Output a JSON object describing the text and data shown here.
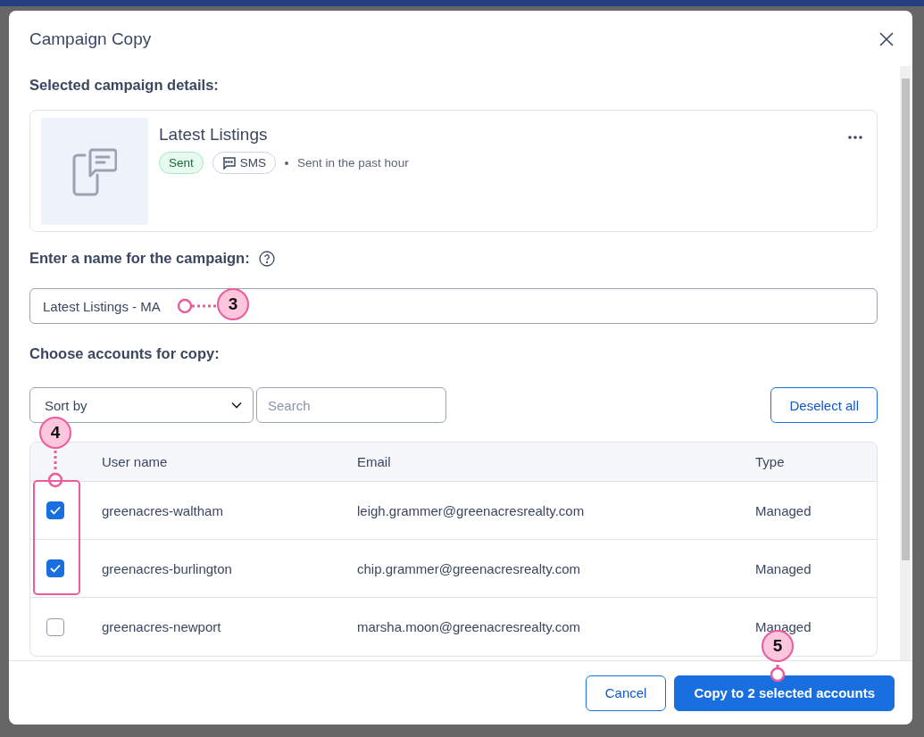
{
  "dialog": {
    "title": "Campaign Copy"
  },
  "campaign": {
    "section_label": "Selected campaign details:",
    "name": "Latest Listings",
    "status": "Sent",
    "channel": "SMS",
    "sent_info": "Sent in the past hour"
  },
  "name_field": {
    "label": "Enter a name for the campaign:",
    "value": "Latest Listings - MA"
  },
  "accounts": {
    "label": "Choose accounts for copy:",
    "sort_by": {
      "value": "Sort by"
    },
    "search": {
      "placeholder": "Search"
    },
    "deselect_button": "Deselect all",
    "columns": [
      "User name",
      "Email",
      "Type"
    ],
    "rows": [
      {
        "user": "greenacres-waltham",
        "email": "leigh.grammer@greenacresrealty.com",
        "type": "Managed",
        "checked": true
      },
      {
        "user": "greenacres-burlington",
        "email": "chip.grammer@greenacresrealty.com",
        "type": "Managed",
        "checked": true
      },
      {
        "user": "greenacres-newport",
        "email": "marsha.moon@greenacresrealty.com",
        "type": "Managed",
        "checked": false
      }
    ]
  },
  "footer": {
    "buttons": [
      {
        "label": "Cancel",
        "kind": "secondary"
      },
      {
        "label": "Copy to 2 selected accounts",
        "kind": "primary"
      }
    ]
  },
  "callouts": [
    {
      "label": "3"
    },
    {
      "label": "4"
    },
    {
      "label": "5"
    }
  ]
}
